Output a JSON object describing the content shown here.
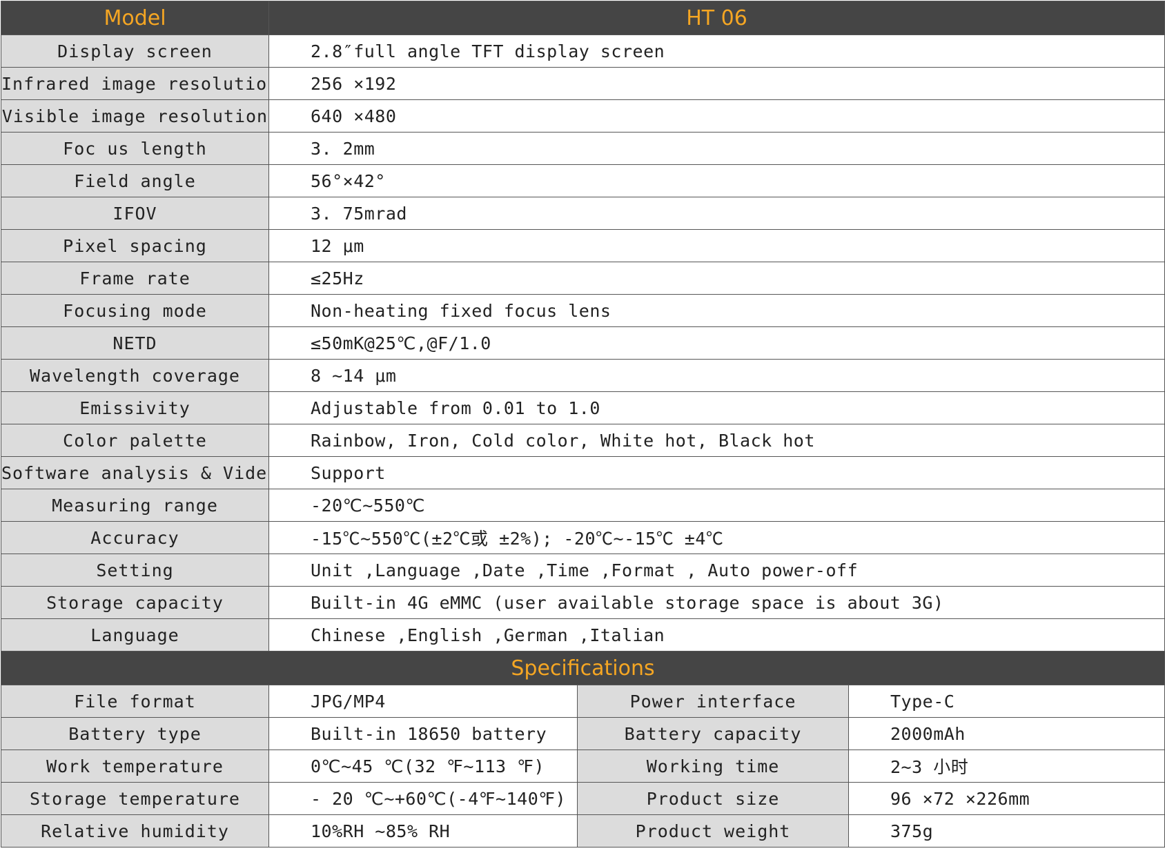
{
  "header": {
    "model_label": "Model",
    "model_value": "HT 06"
  },
  "specs": [
    {
      "label": "Display screen",
      "value": "2.8″full angle TFT  display  screen"
    },
    {
      "label": "Infrared image resolution",
      "value": "256 ×192"
    },
    {
      "label": "Visible image resolution",
      "value": "640 ×480"
    },
    {
      "label": "Foc us length",
      "value": "3. 2mm"
    },
    {
      "label": "Field angle",
      "value": "56°×42°"
    },
    {
      "label": "IFOV",
      "value": "3. 75mrad"
    },
    {
      "label": "Pixel  spacing",
      "value": "12 μm"
    },
    {
      "label": "Frame rate",
      "value": "≤25Hz"
    },
    {
      "label": "Focusing mode",
      "value": "Non-heating fixed focus lens"
    },
    {
      "label": "NETD",
      "value": "≤50mK@25℃,@F/1.0"
    },
    {
      "label": "Wavelength coverage",
      "value": "8 ~14 μm"
    },
    {
      "label": "Emissivity",
      "value": "Adjustable from 0.01 to 1.0"
    },
    {
      "label": "Color palette",
      "value": "Rainbow, Iron, Cold color, White hot, Black hot"
    },
    {
      "label": "Software analysis & Video",
      "value": "Support"
    },
    {
      "label": "Measuring  range",
      "value": "-20℃~550℃"
    },
    {
      "label": "Accuracy",
      "value": "-15℃~550℃(±2℃或 ±2%); -20℃~-15℃ ±4℃"
    },
    {
      "label": "Setting",
      "value": "Unit ,Language ,Date ,Time ,Format , Auto power-off"
    },
    {
      "label": "Storage capacity",
      "value": "Built-in 4G eMMC (user available storage space is about 3G)"
    },
    {
      "label": "Language",
      "value": "Chinese ,English ,German ,Italian"
    }
  ],
  "section": {
    "title": "Specifications"
  },
  "specs2": [
    {
      "label1": "File format",
      "value1": "JPG/MP4",
      "label2": "Power interface",
      "value2": "Type-C"
    },
    {
      "label1": "Battery type",
      "value1": "Built-in 18650 battery",
      "label2": "Battery capacity",
      "value2": "2000mAh"
    },
    {
      "label1": "Work  temperature",
      "value1": "0℃~45 ℃(32 ℉~113 ℉)",
      "label2": "Working time",
      "value2": "2~3 小时"
    },
    {
      "label1": "Storage temperature",
      "value1": "- 20 ℃~+60℃(-4℉~140℉)",
      "label2": "Product size",
      "value2": "96 ×72 ×226mm"
    },
    {
      "label1": "Relative humidity",
      "value1": "10%RH ~85% RH",
      "label2": "Product weight",
      "value2": "375g"
    }
  ],
  "colors": {
    "header_bg": "#454545",
    "header_text": "#f5a623",
    "label_bg": "#dcdcdc",
    "value_bg": "#ffffff",
    "border": "#555555"
  }
}
